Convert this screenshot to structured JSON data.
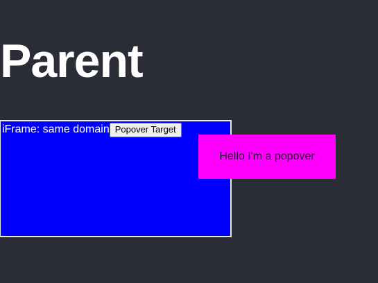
{
  "page": {
    "title": "Parent",
    "background_color": "#2a2d35"
  },
  "iframe": {
    "label": "iFrame: same domain",
    "background_color": "#0000ff",
    "target_button_label": "Popover Target"
  },
  "popover": {
    "text": "Hello I'm a popover",
    "background_color": "#ff00ff"
  }
}
